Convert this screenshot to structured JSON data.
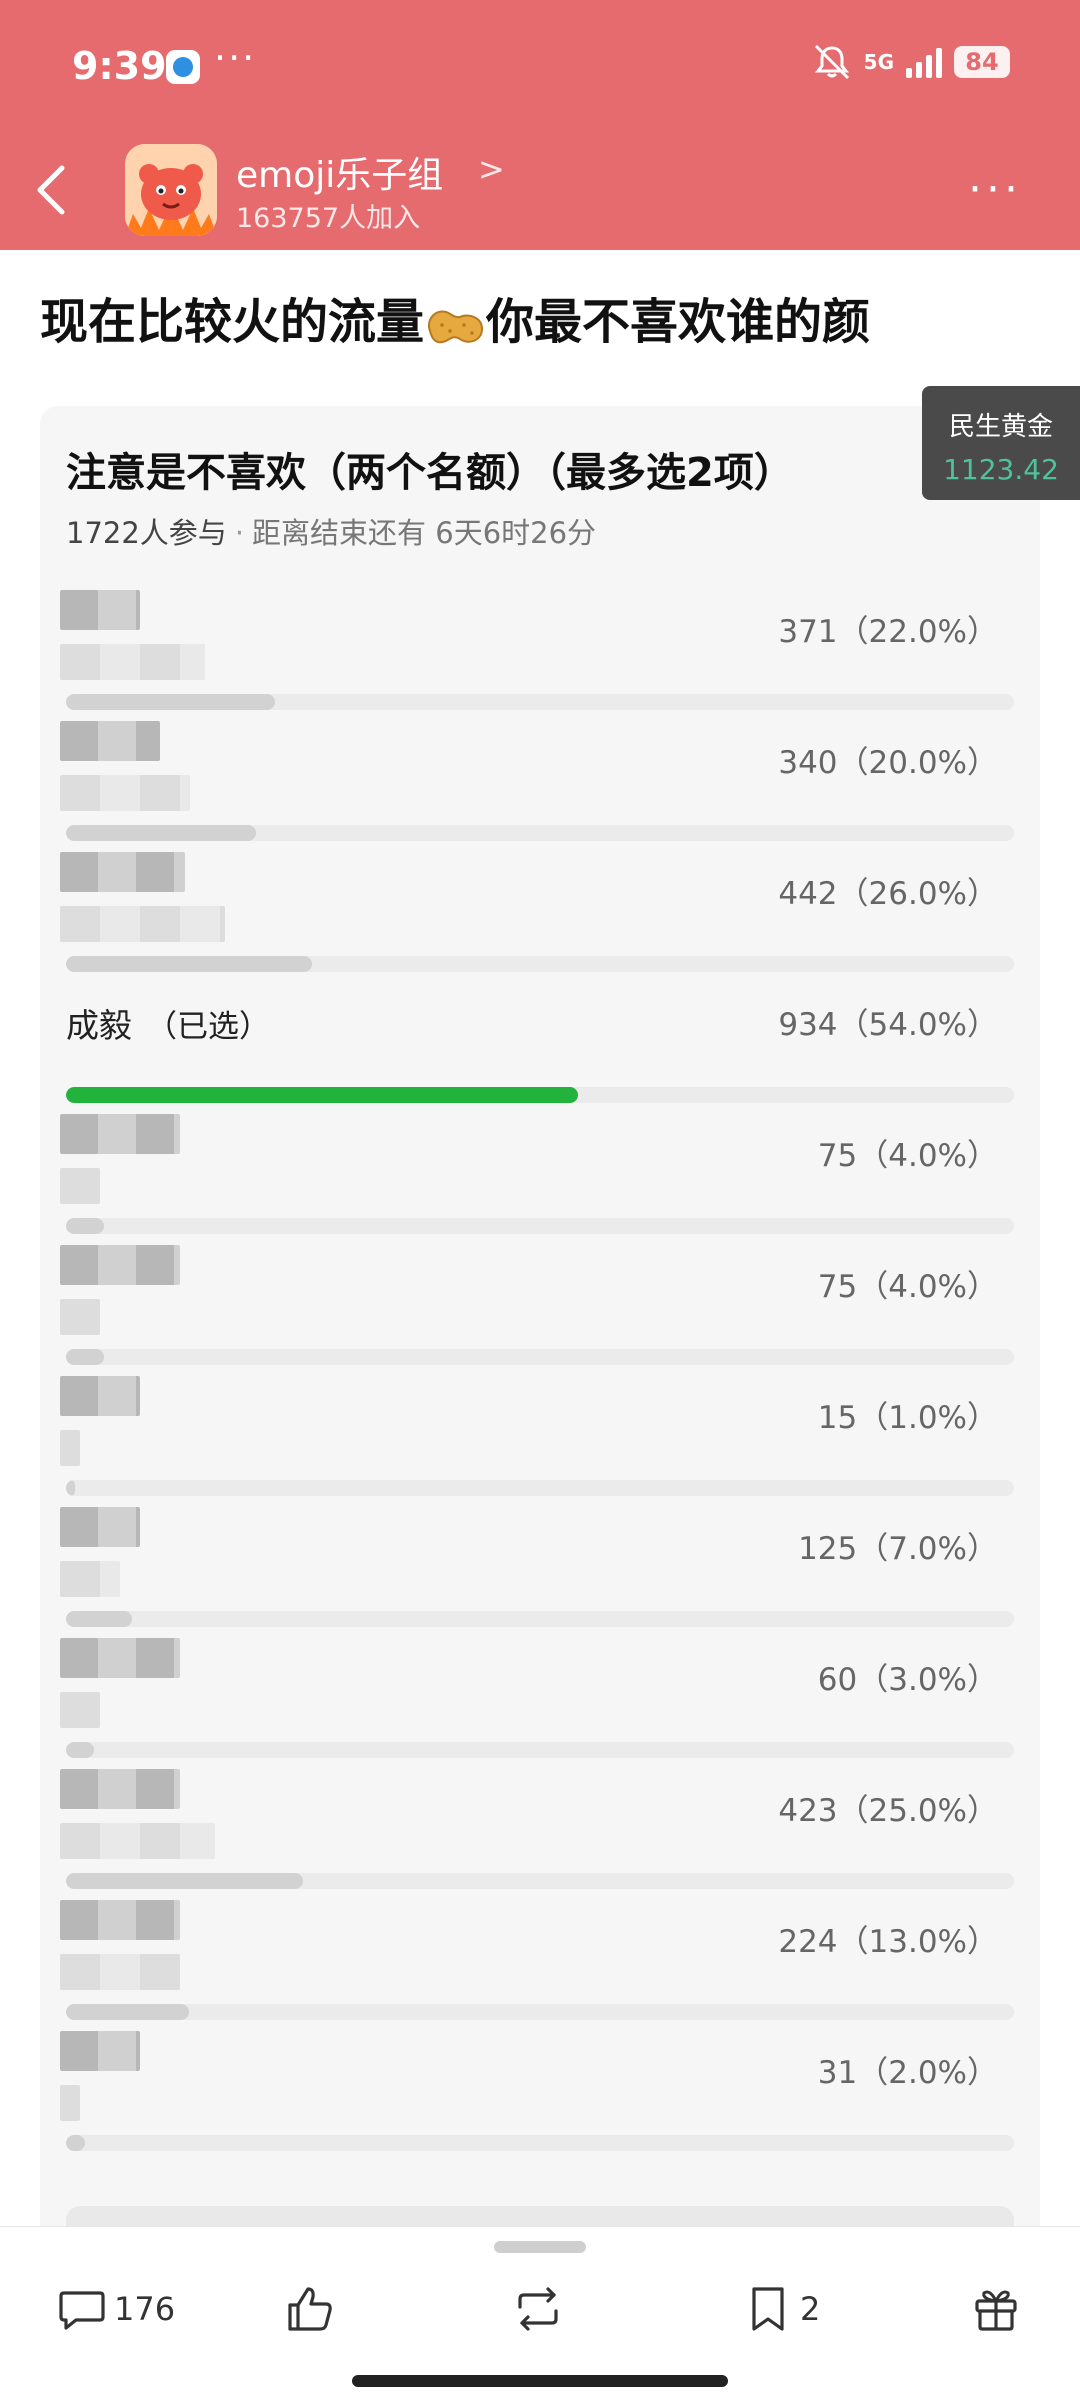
{
  "status_bar": {
    "time": "9:39",
    "more": "···",
    "network": "5G",
    "battery": "84",
    "signal_bars": 4
  },
  "header": {
    "back_icon": "chevron-left-icon",
    "group_name": "emoji乐子组",
    "group_members": "163757人加入",
    "more_label": "···",
    "bg_color": "#e56b6f"
  },
  "post": {
    "title_part1": "现在比较火的流量",
    "title_emoji": "peanut-emoji",
    "title_part2": "你最不喜欢谁的颜"
  },
  "ticker": {
    "name": "民生黄金",
    "value": "1123.42"
  },
  "poll": {
    "title": "注意是不喜欢（两个名额）（最多选2项）",
    "participants": "1722人参与",
    "separator": "·",
    "deadline": "距离结束还有 6天6时26分",
    "options": [
      {
        "label": "",
        "count": "371（22.0%）",
        "percent": 22,
        "selected": false,
        "blur_a": 80,
        "blur_b": 145
      },
      {
        "label": "",
        "count": "340（20.0%）",
        "percent": 20,
        "selected": false,
        "blur_a": 100,
        "blur_b": 130
      },
      {
        "label": "",
        "count": "442（26.0%）",
        "percent": 26,
        "selected": false,
        "blur_a": 125,
        "blur_b": 165
      },
      {
        "label": "成毅",
        "selected_text": "（已选）",
        "count": "934（54.0%）",
        "percent": 54,
        "selected": true
      },
      {
        "label": "",
        "count": "75（4.0%）",
        "percent": 4,
        "selected": false,
        "blur_a": 120,
        "blur_b": 40
      },
      {
        "label": "",
        "count": "75（4.0%）",
        "percent": 4,
        "selected": false,
        "blur_a": 120,
        "blur_b": 40
      },
      {
        "label": "",
        "count": "15（1.0%）",
        "percent": 1,
        "selected": false,
        "blur_a": 80,
        "blur_b": 20
      },
      {
        "label": "",
        "count": "125（7.0%）",
        "percent": 7,
        "selected": false,
        "blur_a": 80,
        "blur_b": 60
      },
      {
        "label": "",
        "count": "60（3.0%）",
        "percent": 3,
        "selected": false,
        "blur_a": 120,
        "blur_b": 40
      },
      {
        "label": "",
        "count": "423（25.0%）",
        "percent": 25,
        "selected": false,
        "blur_a": 120,
        "blur_b": 155
      },
      {
        "label": "",
        "count": "224（13.0%）",
        "percent": 13,
        "selected": false,
        "blur_a": 120,
        "blur_b": 120
      },
      {
        "label": "",
        "count": "31（2.0%）",
        "percent": 2,
        "selected": false,
        "blur_a": 80,
        "blur_b": 20
      }
    ],
    "selected_color": "#22b33d"
  },
  "bottom_bar": {
    "comment_icon": "comment-icon",
    "comments": "176",
    "like_icon": "thumbs-up-icon",
    "repost_icon": "repost-icon",
    "bookmark_icon": "bookmark-icon",
    "bookmarks": "2",
    "gift_icon": "gift-icon"
  }
}
